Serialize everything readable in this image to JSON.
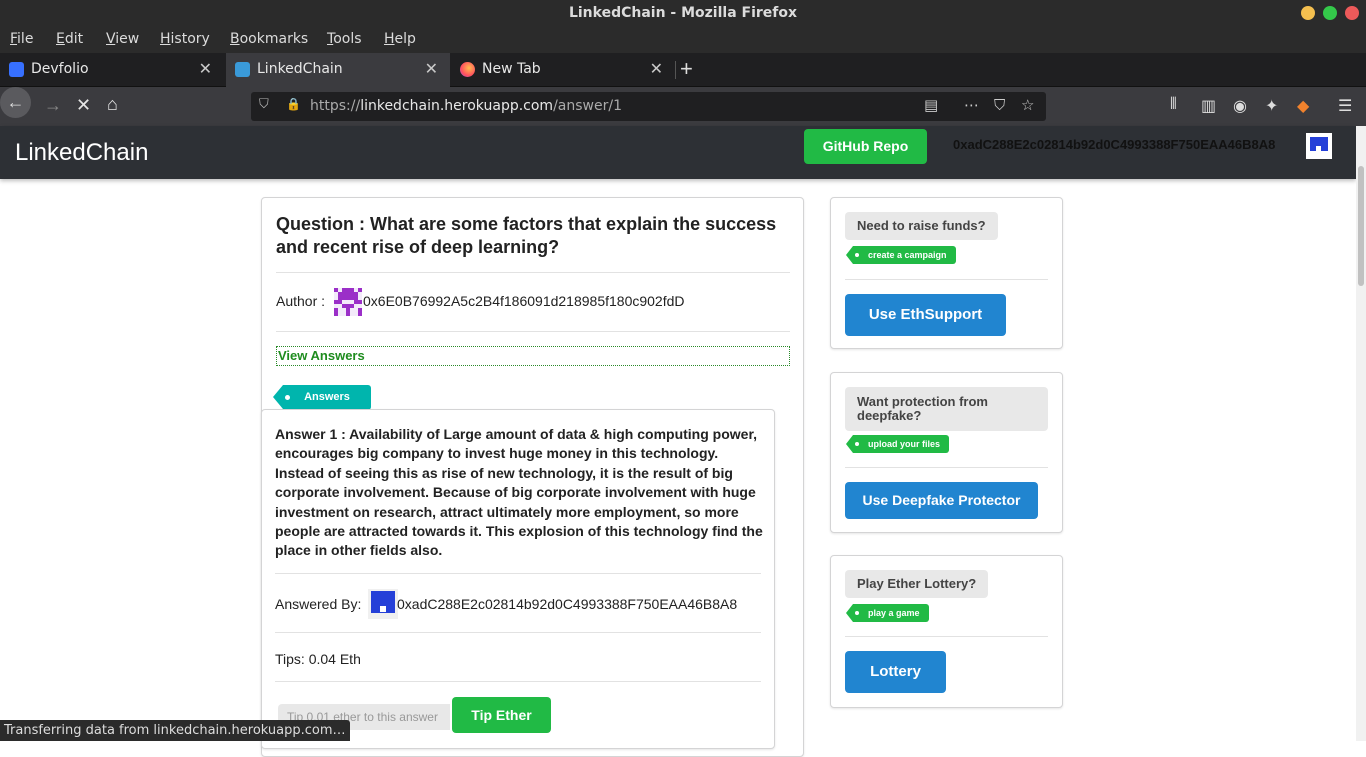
{
  "window": {
    "title": "LinkedChain - Mozilla Firefox"
  },
  "menu": [
    "File",
    "Edit",
    "View",
    "History",
    "Bookmarks",
    "Tools",
    "Help"
  ],
  "tabs": [
    {
      "label": "Devfolio",
      "active": false
    },
    {
      "label": "LinkedChain",
      "active": true
    },
    {
      "label": "New Tab",
      "active": false
    }
  ],
  "url": {
    "scheme": "https://",
    "host": "linkedchain.herokuapp.com",
    "path": "/answer/1"
  },
  "header": {
    "brand": "LinkedChain",
    "github_label": "GitHub Repo",
    "wallet_address": "0xadC288E2c02814b92d0C4993388F750EAA46B8A8"
  },
  "question": {
    "title": "Question : What are some factors that explain the success and recent rise of deep learning?",
    "author_label": "Author :",
    "author_address": "0x6E0B76992A5c2B4f186091d218985f180c902fdD",
    "view_answers": "View Answers",
    "answers_tag": "Answers"
  },
  "answer": {
    "text": "Answer 1 : Availability of Large amount of data & high computing power, encourages big company to invest huge money in this technology. Instead of seeing this as rise of new technology, it is the result of big corporate involvement. Because of big corporate involvement with huge investment on research, attract ultimately more employment, so more people are attracted towards it. This explosion of this technology find the place in other fields also.",
    "answered_by_label": "Answered By:",
    "answered_by_address": "0xadC288E2c02814b92d0C4993388F750EAA46B8A8",
    "tips": "Tips: 0.04 Eth",
    "tip_placeholder": "Tip 0.01 ether to this answer",
    "tip_button": "Tip Ether"
  },
  "sidebar": [
    {
      "label": "Need to raise funds?",
      "tag": "create a campaign",
      "button": "Use EthSupport"
    },
    {
      "label": "Want protection from deepfake?",
      "tag": "upload your files",
      "button": "Use Deepfake Protector"
    },
    {
      "label": "Play Ether Lottery?",
      "tag": "play a game",
      "button": "Lottery"
    }
  ],
  "status": "Transferring data from linkedchain.herokuapp.com…",
  "colors": {
    "green": "#21ba45",
    "blue": "#2185d0",
    "teal": "#00b5ad",
    "header_bg": "#2d3035"
  }
}
